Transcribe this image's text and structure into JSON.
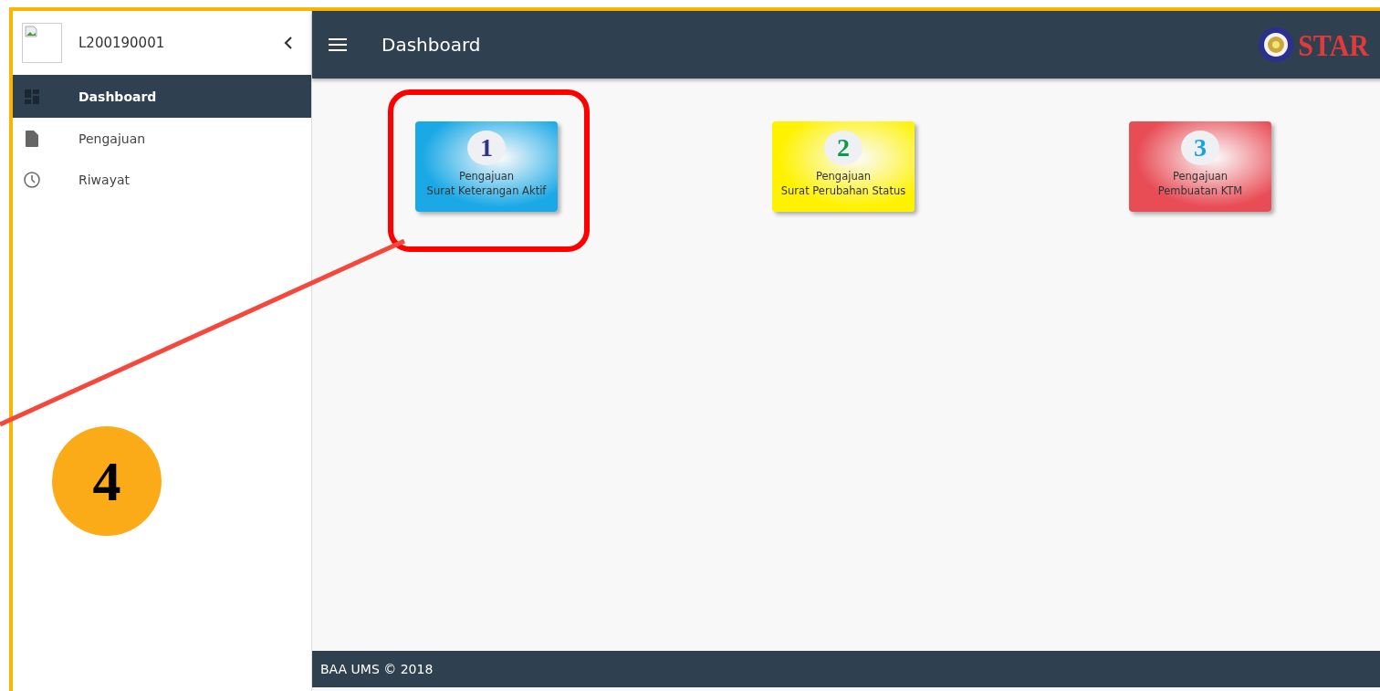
{
  "sidebar": {
    "user": "L200190001",
    "items": [
      {
        "kind": "dashboard",
        "label": "Dashboard",
        "selected": true
      },
      {
        "kind": "file",
        "label": "Pengajuan",
        "selected": false
      },
      {
        "kind": "clock",
        "label": "Riwayat",
        "selected": false
      }
    ]
  },
  "topbar": {
    "title": "Dashboard",
    "logo_text": "STAR"
  },
  "cards": [
    {
      "number": {
        "text": "1",
        "color": "#2e3192"
      },
      "line1": "Pengajuan",
      "line2": "Surat Keterangan Aktif",
      "color": "#1aa9e6"
    },
    {
      "number": {
        "text": "2",
        "color": "#0a9a4a"
      },
      "line1": "Pengajuan",
      "line2": "Surat Perubahan Status",
      "color": "#fff200"
    },
    {
      "number": {
        "text": "3",
        "color": "#1aa3e0"
      },
      "line1": "Pengajuan",
      "line2": "Pembuatan KTM",
      "color": "#e84c55"
    }
  ],
  "footer": "BAA UMS © 2018",
  "annotation": {
    "step": "4"
  }
}
